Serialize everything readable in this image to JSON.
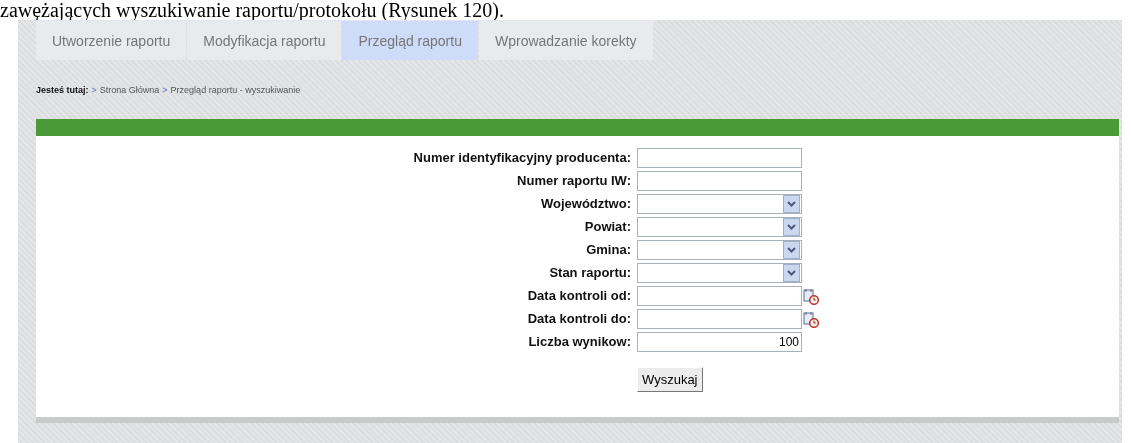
{
  "document_text": "zawężających wyszukiwanie raportu/protokołu (Rysunek 120).",
  "tabs": [
    {
      "label": "Utworzenie raportu",
      "selected": false
    },
    {
      "label": "Modyfikacja raportu",
      "selected": false
    },
    {
      "label": "Przegląd raportu",
      "selected": true
    },
    {
      "label": "Wprowadzanie korekty",
      "selected": false
    }
  ],
  "breadcrumb": {
    "prefix": "Jesteś tutaj:",
    "separator": ">",
    "items": [
      "Strona Główna",
      "Przegląd raportu - wyszukiwanie"
    ]
  },
  "form": {
    "fields": [
      {
        "label": "Numer identyfikacyjny producenta:",
        "kind": "text"
      },
      {
        "label": "Numer raportu IW:",
        "kind": "text"
      },
      {
        "label": "Województwo:",
        "kind": "select"
      },
      {
        "label": "Powiat:",
        "kind": "select"
      },
      {
        "label": "Gmina:",
        "kind": "select"
      },
      {
        "label": "Stan raportu:",
        "kind": "select"
      },
      {
        "label": "Data kontroli od:",
        "kind": "date"
      },
      {
        "label": "Data kontroli do:",
        "kind": "date"
      },
      {
        "label": "Liczba wynikow:",
        "kind": "text",
        "value": "100"
      }
    ],
    "submit": "Wyszukaj"
  }
}
